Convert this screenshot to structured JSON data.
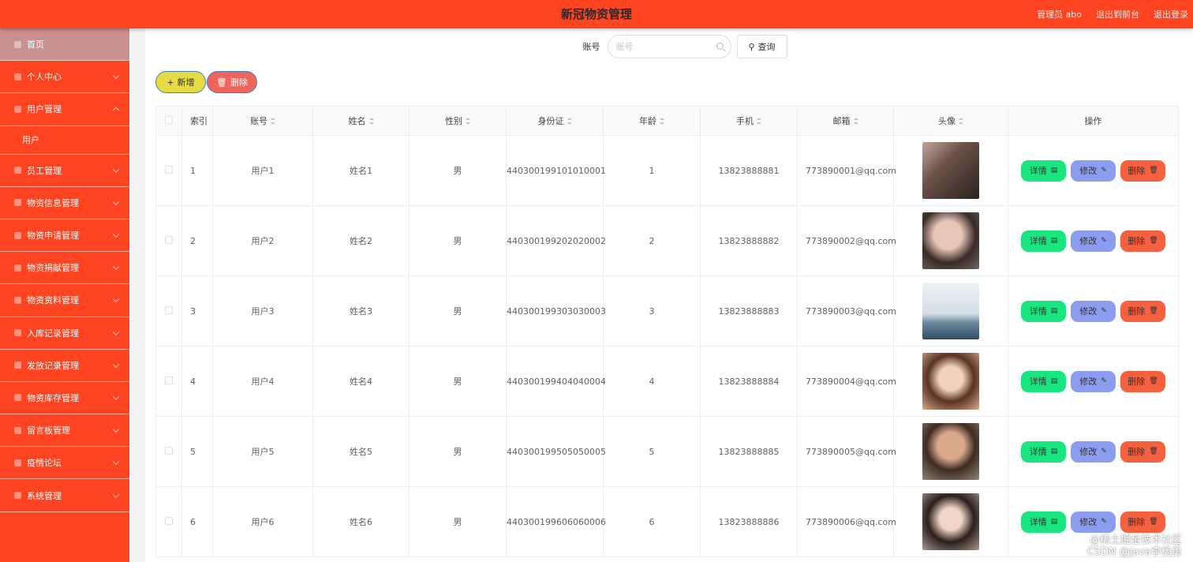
{
  "header": {
    "title": "新冠物资管理",
    "admin": "管理员 abo",
    "back": "退出到前台",
    "logout": "退出登录"
  },
  "sidebar": {
    "items": [
      {
        "label": "首页",
        "icon": "home-icon"
      },
      {
        "label": "个人中心",
        "icon": "user-icon"
      },
      {
        "label": "用户管理",
        "icon": "users-icon",
        "expanded": true,
        "sub": [
          "用户"
        ]
      },
      {
        "label": "员工管理",
        "icon": "grid-icon"
      },
      {
        "label": "物资信息管理",
        "icon": "box-icon"
      },
      {
        "label": "物资申请管理",
        "icon": "apply-icon"
      },
      {
        "label": "物资捐献管理",
        "icon": "donate-icon"
      },
      {
        "label": "物资资料管理",
        "icon": "doc-icon"
      },
      {
        "label": "入库记录管理",
        "icon": "inbound-icon"
      },
      {
        "label": "发放记录管理",
        "icon": "mic-icon"
      },
      {
        "label": "物资库存管理",
        "icon": "flag-icon"
      },
      {
        "label": "留言板管理",
        "icon": "message-icon"
      },
      {
        "label": "疫情论坛",
        "icon": "send-icon"
      },
      {
        "label": "系统管理",
        "icon": "settings-icon"
      }
    ]
  },
  "search": {
    "label": "账号",
    "placeholder": "账号",
    "button": "查询"
  },
  "toolbar": {
    "add_label": "新增",
    "delete_label": "删除"
  },
  "table": {
    "columns": [
      "索引",
      "账号",
      "姓名",
      "性别",
      "身份证",
      "年龄",
      "手机",
      "邮箱",
      "头像",
      "操作"
    ],
    "rows": [
      {
        "index": "1",
        "account": "用户1",
        "name": "姓名1",
        "gender": "男",
        "idcard": "440300199101010001",
        "age": "1",
        "phone": "13823888881",
        "email": "773890001@qq.com"
      },
      {
        "index": "2",
        "account": "用户2",
        "name": "姓名2",
        "gender": "男",
        "idcard": "440300199202020002",
        "age": "2",
        "phone": "13823888882",
        "email": "773890002@qq.com"
      },
      {
        "index": "3",
        "account": "用户3",
        "name": "姓名3",
        "gender": "男",
        "idcard": "440300199303030003",
        "age": "3",
        "phone": "13823888883",
        "email": "773890003@qq.com"
      },
      {
        "index": "4",
        "account": "用户4",
        "name": "姓名4",
        "gender": "男",
        "idcard": "440300199404040004",
        "age": "4",
        "phone": "13823888884",
        "email": "773890004@qq.com"
      },
      {
        "index": "5",
        "account": "用户5",
        "name": "姓名5",
        "gender": "男",
        "idcard": "440300199505050005",
        "age": "5",
        "phone": "13823888885",
        "email": "773890005@qq.com"
      },
      {
        "index": "6",
        "account": "用户6",
        "name": "姓名6",
        "gender": "男",
        "idcard": "440300199606060006",
        "age": "6",
        "phone": "13823888886",
        "email": "773890006@qq.com"
      }
    ],
    "ops": {
      "detail": "详情",
      "edit": "修改",
      "delete": "删除"
    }
  },
  "watermark": {
    "line1": "@稀土掘金技术社区",
    "line2": "CSDN @java李杨勇"
  },
  "colors": {
    "brand": "#ff4422",
    "detail": "#19e67f",
    "edit": "#8c9cf0",
    "delete": "#f5603f",
    "add": "#e6db42"
  }
}
